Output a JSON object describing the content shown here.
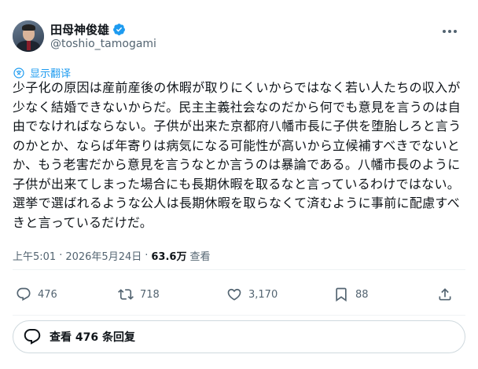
{
  "author": {
    "display_name": "田母神俊雄",
    "handle": "@toshio_tamogami",
    "verified_color": "#1d9bf0"
  },
  "translate_label": "显示翻译",
  "tweet": {
    "text": "少子化の原因は産前産後の休暇が取りにくいからではなく若い人たちの収入が少なく結婚できないからだ。民主主義社会なのだから何でも意見を言うのは自由でなければならない。子供が出来た京都府八幡市長に子供を堕胎しろと言うのかとか、ならば年寄りは病気になる可能性が高いから立候補すべきでないとか、もう老害だから意見を言うなとか言うのは暴論である。八幡市長のように子供が出来てしまった場合にも長期休暇を取るなと言っているわけではない。選挙で選ばれるような公人は長期休暇を取らなくて済むように事前に配慮すべきと言っているだけだ。"
  },
  "meta": {
    "time": "上午5:01",
    "separator": "·",
    "date": "2026年5月24日",
    "views_count": "63.6万",
    "views_label": "查看"
  },
  "actions": {
    "reply_count": "476",
    "retweet_count": "718",
    "like_count": "3,170",
    "bookmark_count": "88"
  },
  "replies_button_label": "查看 476 条回复",
  "icons": {
    "translate": "translate-icon",
    "reply": "reply-icon",
    "retweet": "retweet-icon",
    "like": "heart-icon",
    "bookmark": "bookmark-icon",
    "share": "share-icon",
    "more": "more-icon",
    "verified": "verified-badge-icon"
  }
}
